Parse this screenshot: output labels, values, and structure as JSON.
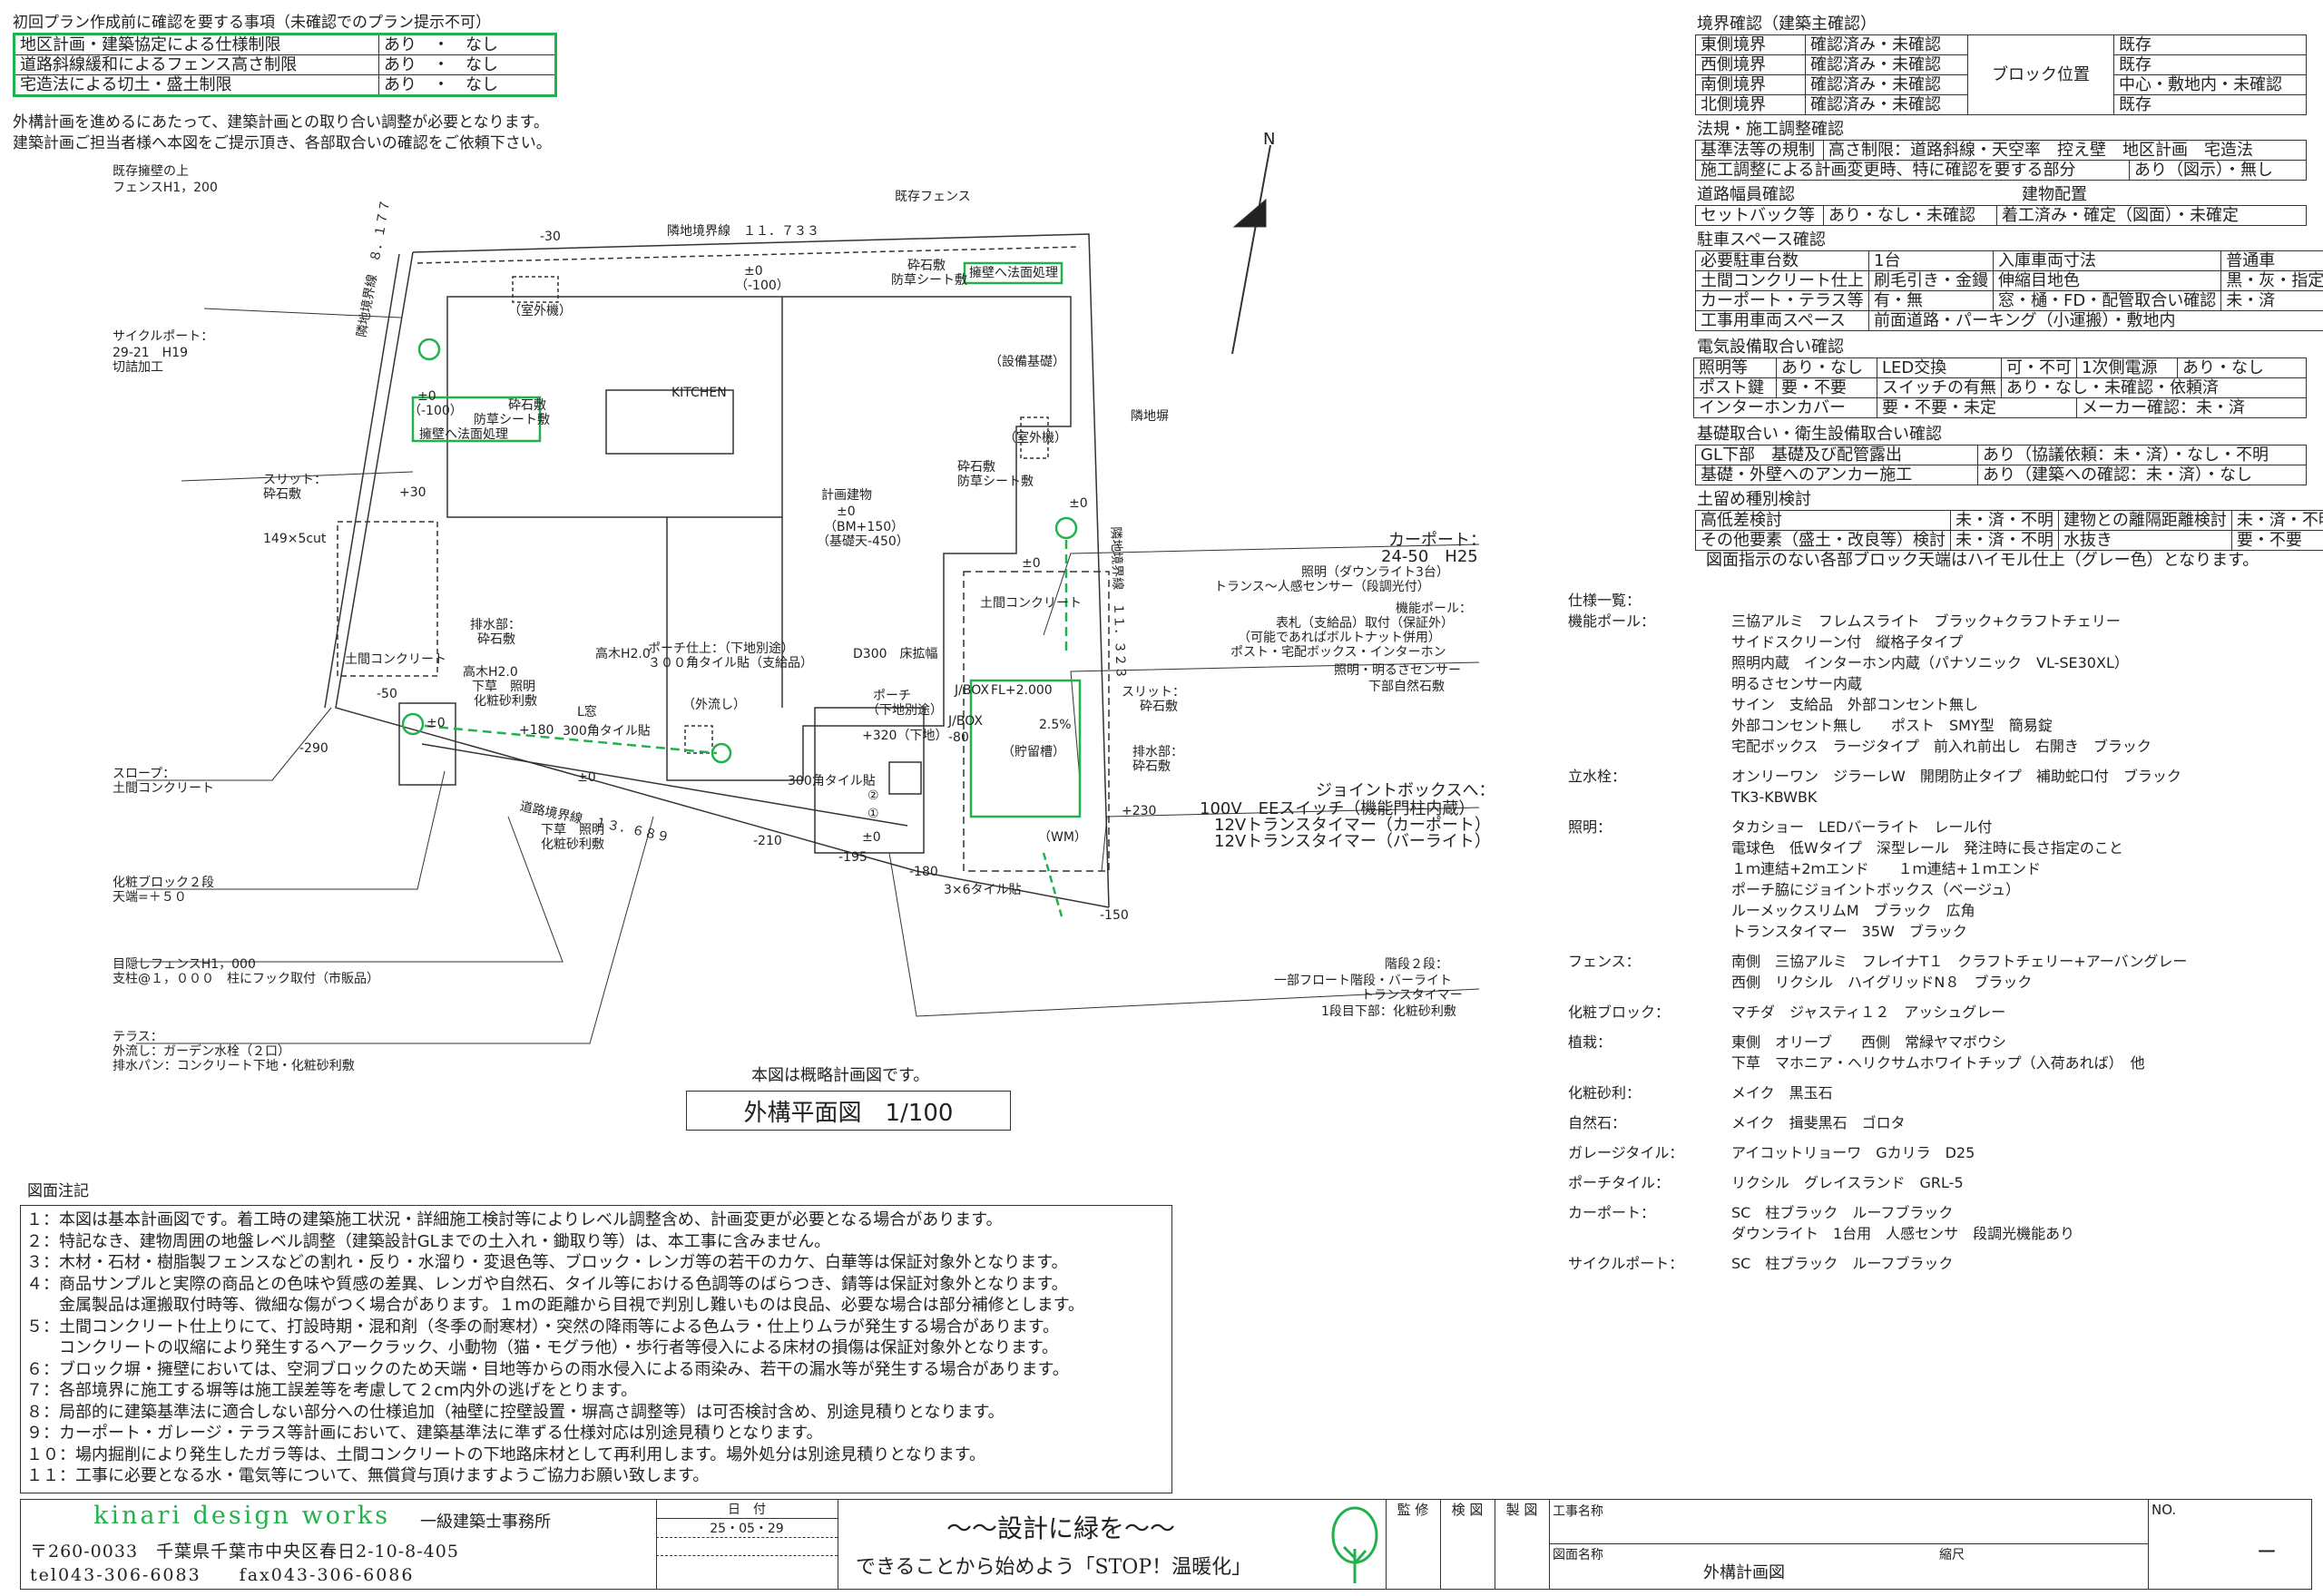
{
  "top_check": {
    "title": "初回プラン作成前に確認を要する事項（未確認でのプラン提示不可）",
    "rows": [
      {
        "label": "地区計画・建築協定による仕様制限",
        "value": "あり　・　なし"
      },
      {
        "label": "道路斜線緩和によるフェンス高さ制限",
        "value": "あり　・　なし"
      },
      {
        "label": "宅造法による切土・盛土制限",
        "value": "あり　・　なし"
      }
    ],
    "note_lines": [
      "外構計画を進めるにあたって、建築計画との取り合い調整が必要となります。",
      "建築計画ご担当者様へ本図をご提示頂き、各部取合いの確認をご依頼下さい。"
    ]
  },
  "boundary": {
    "title": "境界確認（建築主確認）",
    "rows": [
      {
        "side": "東側境界",
        "status": "確認済み・未確認",
        "right": "既存"
      },
      {
        "side": "西側境界",
        "status": "確認済み・未確認",
        "right": "既存"
      },
      {
        "side": "南側境界",
        "status": "確認済み・未確認",
        "right": "中心・敷地内・未確認"
      },
      {
        "side": "北側境界",
        "status": "確認済み・未確認",
        "right": "既存"
      }
    ],
    "block_label": "ブロック位置"
  },
  "law": {
    "title": "法規・施工調整確認",
    "row1_left": "基準法等の規制",
    "row1_right": "高さ制限：道路斜線・天空率　控え壁　地区計画　宅造法",
    "row2_left": "施工調整による計画変更時、特に確認を要する部分",
    "row2_right": "あり（図示）・無し"
  },
  "road": {
    "title": "道路幅員確認",
    "title2": "建物配置",
    "left": "セットバック等",
    "mid": "あり・なし・未確認",
    "right": "着工済み・確定（図面）・未確定"
  },
  "parking": {
    "title": "駐車スペース確認",
    "rows": [
      [
        "必要駐車台数",
        "1台",
        "入庫車両寸法",
        "普通車"
      ],
      [
        "土間コンクリート仕上",
        "刷毛引き・金鏝",
        "伸縮目地色",
        "黒・灰・指定無"
      ],
      [
        "カーポート・テラス等",
        "有・無",
        "窓・樋・FD・配管取合い確認",
        "未・済"
      ],
      [
        "工事用車両スペース",
        "前面道路・パーキング（小運搬）・敷地内",
        "",
        ""
      ]
    ]
  },
  "electric": {
    "title": "電気設備取合い確認",
    "rows": [
      [
        "照明等",
        "あり・なし",
        "LED交換",
        "可・不可",
        "1次側電源",
        "あり・なし"
      ],
      [
        "ポスト鍵",
        "要・不要",
        "スイッチの有無",
        "あり・なし・未確認・依頼済",
        "",
        ""
      ],
      [
        "インターホンカバー",
        "要・不要・未定",
        "",
        "",
        "メーカー確認：未・済",
        ""
      ]
    ]
  },
  "foundation": {
    "title": "基礎取合い・衛生設備取合い確認",
    "rows": [
      [
        "GL下部　基礎及び配管露出",
        "あり（協議依頼：未・済）・なし・不明"
      ],
      [
        "基礎・外壁へのアンカー施工",
        "あり（建築への確認：未・済）・なし"
      ]
    ]
  },
  "retaining": {
    "title": "土留め種別検討",
    "rows": [
      [
        "高低差検討",
        "未・済・不明",
        "建物との離隔距離検討",
        "未・済・不明"
      ],
      [
        "その他要素（盛土・改良等）検討",
        "未・済・不明",
        "水抜き",
        "要・不要"
      ]
    ],
    "footnote": "図面指示のない各部ブロック天端はハイモル仕上（グレー色）となります。"
  },
  "specs": {
    "title": "仕様一覧：",
    "items": [
      {
        "k": "機能ポール：",
        "v": [
          "三協アルミ　フレムスライト　ブラック+クラフトチェリー",
          "サイドスクリーン付　縦格子タイプ",
          "照明内蔵　インターホン内蔵（パナソニック　VL-SE30XL）",
          "明るさセンサー内蔵",
          "サイン　支給品　外部コンセント無し",
          "外部コンセント無し　　ポスト　SMY型　簡易錠",
          "宅配ボックス　ラージタイプ　前入れ前出し　右開き　ブラック"
        ]
      },
      {
        "k": "立水栓：",
        "v": [
          "オンリーワン　ジラーレW　開閉防止タイプ　補助蛇口付　ブラック",
          "TK3-KBWBK"
        ]
      },
      {
        "k": "照明：",
        "v": [
          "タカショー　LEDバーライト　レール付",
          "電球色　低Wタイプ　深型レール　発注時に長さ指定のこと",
          "１ｍ連結+2ｍエンド　　１ｍ連結+１ｍエンド",
          "ポーチ脇にジョイントボックス（ベージュ）",
          "ルーメックスリムM　ブラック　広角",
          "トランスタイマー　35W　ブラック"
        ]
      },
      {
        "k": "フェンス：",
        "v": [
          "南側　三協アルミ　フレイナT１　クラフトチェリー+アーバングレー",
          "西側　リクシル　ハイグリッドN８　ブラック"
        ]
      },
      {
        "k": "化粧ブロック：",
        "v": [
          "マチダ　ジャスティ１２　アッシュグレー"
        ]
      },
      {
        "k": "植栽：",
        "v": [
          "東側　オリーブ　　西側　常緑ヤマボウシ",
          "下草　マホニア・ヘリクサムホワイトチップ（入荷あれば）　他"
        ]
      },
      {
        "k": "化粧砂利：",
        "v": [
          "メイク　黒玉石"
        ]
      },
      {
        "k": "自然石：",
        "v": [
          "メイク　揖斐黒石　ゴロタ"
        ]
      },
      {
        "k": "ガレージタイル：",
        "v": [
          "アイコットリョーワ　Gカリラ　D25"
        ]
      },
      {
        "k": "ポーチタイル：",
        "v": [
          "リクシル　グレイスランド　GRL-5"
        ]
      },
      {
        "k": "カーポート：",
        "v": [
          "SC　柱ブラック　ルーフブラック",
          "ダウンライト　1台用　人感センサ　段調光機能あり"
        ]
      },
      {
        "k": "サイクルポート：",
        "v": [
          "SC　柱ブラック　ルーフブラック"
        ]
      }
    ]
  },
  "notes": {
    "title": "図面注記",
    "lines": [
      "１：本図は基本計画図です。着工時の建築施工状況・詳細施工検討等によりレベル調整含め、計画変更が必要となる場合があります。",
      "２：特記なき、建物周囲の地盤レベル調整（建築設計GLまでの土入れ・鋤取り等）は、本工事に含みません。",
      "３：木材・石材・樹脂製フェンスなどの割れ・反り・水溜り・変退色等、ブロック・レンガ等の若干のカケ、白華等は保証対象外となります。",
      "４：商品サンプルと実際の商品との色味や質感の差異、レンガや自然石、タイル等における色調等のばらつき、錆等は保証対象外となります。",
      "　　金属製品は運搬取付時等、微細な傷がつく場合があります。１mの距離から目視で判別し難いものは良品、必要な場合は部分補修とします。",
      "５：土間コンクリート仕上りにて、打設時期・混和剤（冬季の耐寒材）・突然の降雨等による色ムラ・仕上りムラが発生する場合があります。",
      "　　コンクリートの収縮により発生するヘアークラック、小動物（猫・モグラ他）・歩行者等侵入による床材の損傷は保証対象外となります。",
      "６：ブロック塀・擁壁においては、空洞ブロックのため天端・目地等からの雨水侵入による雨染み、若干の漏水等が発生する場合があります。",
      "７：各部境界に施工する塀等は施工誤差等を考慮して２cm内外の逃げをとります。",
      "８：局部的に建築基準法に適合しない部分への仕様追加（袖壁に控壁設置・塀高さ調整等）は可否検討含め、別途見積りとなります。",
      "９：カーポート・ガレージ・テラス等計画において、建築基準法に準ずる仕様対応は別途見積りとなります。",
      "１０：場内掘削により発生したガラ等は、土間コンクリートの下地路床材として再利用します。場外処分は別途見積りとなります。",
      "１１：工事に必要となる水・電気等について、無償貸与頂けますようご協力お願い致します。"
    ]
  },
  "plan": {
    "note": "本図は概略計画図です。",
    "title": "外構平面図　1/100",
    "labels": {
      "existing_wall": "既存擁壁の上",
      "fence_h": "フェンスH1，200",
      "existing_fence": "既存フェンス",
      "neighbor_line": "隣地境界線　１１．７３３",
      "neighbor_line_w": "隣地境界線　８．１７７",
      "neighbor_line_e": "隣地境界線　１１．３２３",
      "road_line": "道路境界線　１３．６８９",
      "cycle": "サイクルポート：",
      "cycle2": "29-21　H19",
      "cycle3": "切詰加工",
      "slit": "スリット：",
      "slit2": "砕石敷",
      "cut": "149×5cut",
      "slope": "スロープ：",
      "slope2": "土間コンクリート",
      "block": "化粧ブロック２段",
      "block2": "天端=＋５０",
      "screen": "目隠しフェンスH1，000",
      "screen2": "支柱@１，０００　柱にフック取付（市販品）",
      "terrace": "テラス：",
      "terrace2": "外流し：ガーデン水栓（２口）",
      "terrace3": "排水パン：コンクリート下地・化粧砂利敷",
      "building": "計画建物",
      "building2": "±0",
      "building3": "（BM+150）",
      "building4": "（基礎天-450）",
      "kitchen": "KITCHEN",
      "outdoor_unit": "（室外機）",
      "equipment": "（設備基礎）",
      "gravel": "砕石敷",
      "gravel_sheet": "防草シート敷",
      "slope_treat": "擁壁へ法面処理",
      "concrete": "土間コンクリート",
      "porch": "ポーチ",
      "porch2": "（下地別途）",
      "tile300": "300角タイル貼",
      "tile3x6": "3×6タイル貼",
      "carport": "カーポート：",
      "carport2": "24-50　H25",
      "carport3": "照明（ダウンライト3台）",
      "carport4": "トランス～人感センサー（段調光付）",
      "pole": "機能ポール：",
      "pole2": "表札（支給品）取付（保証外）",
      "pole3": "（可能であればボルトナット併用）",
      "pole4": "ポスト・宅配ボックス・インターホン",
      "pole5": "照明・明るさセンサー",
      "pole6": "下部自然石敷",
      "joint": "ジョイントボックスへ：",
      "joint2": "100V　EEスイッチ（機能門柱内蔵）",
      "joint3": "12Vトランスタイマー（カーポート）",
      "joint4": "12Vトランスタイマー（バーライト）",
      "steps": "階段２段：",
      "steps2": "一部フロート階段・バーライト",
      "steps3": "トランスタイマー",
      "steps4": "1段目下部：化粧砂利敷",
      "drain": "排水部：",
      "drain2": "砕石敷",
      "tree": "高木H2.0",
      "under": "下草　照明",
      "under2": "化粧砂利敷",
      "window": "L窓",
      "tile_porch": "ポーチ仕上：（下地別途）",
      "tile_porch2": "３００角タイル貼（支給品）",
      "d300": "D300　床拡幅",
      "sink": "（外流し）",
      "storage": "（貯留槽）",
      "slope_pct": "2.5%",
      "jbox": "J/BOX",
      "fl": "FL+2.000",
      "wm": "（WM）",
      "neighbor_wall": "隣地塀",
      "lv_0": "±0",
      "lv_m100": "（-100）",
      "lv_p30": "+30",
      "lv_m30": "-30",
      "lv_p180": "+180",
      "lv_m290": "-290",
      "lv_m50": "-50",
      "lv_p320": "+320（下地）",
      "lv_m80": "-80",
      "lv_m210": "-210",
      "lv_m195": "-195",
      "lv_m180": "-180",
      "lv_m150": "-150",
      "lv_p230": "+230",
      "lv_m10": "±0",
      "circ2": "②",
      "circ1": "①",
      "north": "N"
    }
  },
  "titleblock": {
    "company": "kinari design works",
    "company2": "一級建築士事務所",
    "addr": "〒260-0033　千葉県千葉市中央区春日2-10-8-405",
    "tel": "tel043-306-6083　　fax043-306-6086",
    "date_label": "日　付",
    "date": "25・05・29",
    "slogan1": "～～設計に緑を～～",
    "slogan2": "できることから始めよう「STOP！温暖化」",
    "supervise": "監 修",
    "inspect": "検 図",
    "draft": "製 図",
    "project": "工事名称",
    "drawing_name": "図面名称",
    "drawing": "外構計画図",
    "scale": "縮尺",
    "no": "NO.",
    "no_val": "ー"
  }
}
